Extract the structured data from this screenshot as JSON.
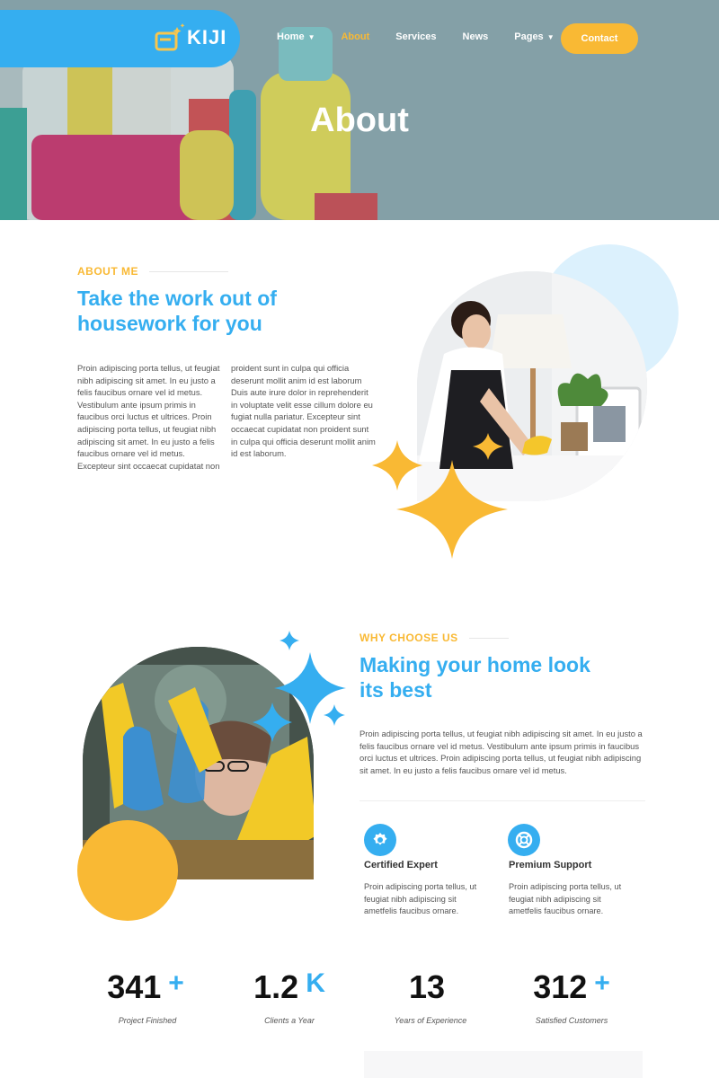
{
  "brand": {
    "name": "KIJI",
    "accent": "#35aef0",
    "secondary": "#f9b934"
  },
  "nav": {
    "items": [
      {
        "label": "Home",
        "has_caret": true,
        "active": false
      },
      {
        "label": "About",
        "has_caret": false,
        "active": true
      },
      {
        "label": "Services",
        "has_caret": false,
        "active": false
      },
      {
        "label": "News",
        "has_caret": false,
        "active": false
      },
      {
        "label": "Pages",
        "has_caret": true,
        "active": false
      }
    ],
    "contact_label": "Contact"
  },
  "hero": {
    "title": "About"
  },
  "about": {
    "eyebrow": "ABOUT ME",
    "heading_line1": "Take the work out of",
    "heading_line2": "housework for you",
    "col1": "Proin adipiscing porta tellus, ut feugiat nibh adipiscing sit amet. In eu justo a felis faucibus ornare vel id metus. Vestibulum ante ipsum primis in faucibus orci luctus et ultrices. Proin adipiscing porta tellus, ut feugiat nibh adipiscing sit amet. In eu justo a felis faucibus ornare vel id metus. Excepteur sint occaecat cupidatat non",
    "col2": "proident sunt in culpa qui officia deserunt mollit anim id est laborum Duis aute irure dolor in reprehenderit in voluptate velit esse cillum dolore eu fugiat nulla pariatur. Excepteur sint occaecat cupidatat non proident sunt in culpa qui officia deserunt mollit anim id est laborum."
  },
  "why": {
    "eyebrow": "WHY CHOOSE US",
    "heading_line1": "Making your home look",
    "heading_line2": "its best",
    "body": "Proin adipiscing porta tellus, ut feugiat nibh adipiscing sit amet. In eu justo a felis faucibus ornare vel id metus. Vestibulum ante ipsum primis in faucibus orci luctus et ultrices. Proin adipiscing porta tellus, ut feugiat nibh adipiscing sit amet. In eu justo a felis faucibus ornare vel id metus.",
    "features": [
      {
        "icon": "badge-icon",
        "title": "Certified Expert",
        "text": "Proin adipiscing porta tellus, ut feugiat nibh adipiscing sit ametfelis faucibus ornare."
      },
      {
        "icon": "lifebuoy-icon",
        "title": "Premium Support",
        "text": "Proin adipiscing porta tellus, ut feugiat nibh adipiscing sit ametfelis faucibus ornare."
      }
    ]
  },
  "stats": [
    {
      "value": "341",
      "suffix": "+",
      "label": "Project Finished"
    },
    {
      "value": "1.2",
      "suffix": "K",
      "label": "Clients a Year"
    },
    {
      "value": "13",
      "suffix": "",
      "label": "Years of Experience"
    },
    {
      "value": "312",
      "suffix": "+",
      "label": "Satisfied Customers"
    }
  ]
}
